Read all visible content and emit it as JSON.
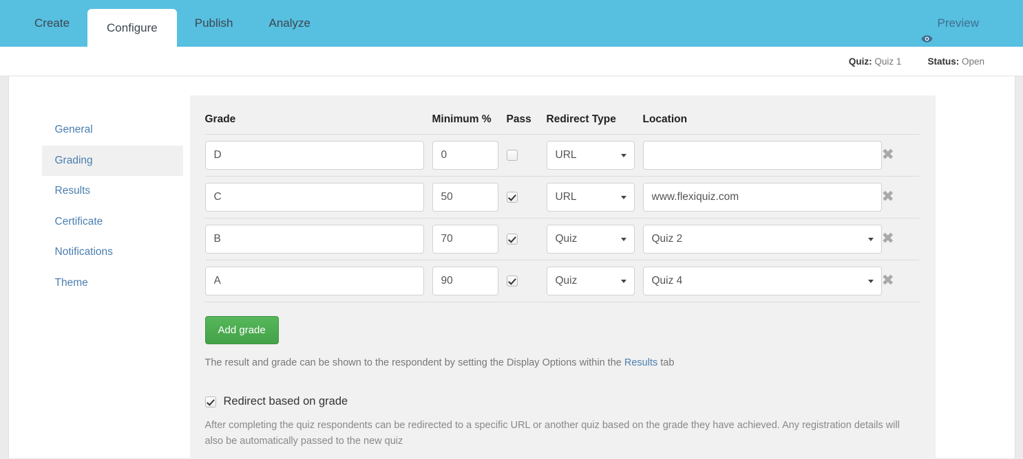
{
  "topbar": {
    "tabs": [
      {
        "label": "Create",
        "active": false
      },
      {
        "label": "Configure",
        "active": true
      },
      {
        "label": "Publish",
        "active": false
      },
      {
        "label": "Analyze",
        "active": false
      }
    ],
    "preview_label": "Preview",
    "preview_icon": "eye-icon",
    "accent_color": "#57bfdf"
  },
  "statusbar": {
    "quiz_label": "Quiz:",
    "quiz_value": "Quiz 1",
    "status_label": "Status:",
    "status_value": "Open"
  },
  "subnav": {
    "items": [
      {
        "label": "General",
        "active": false
      },
      {
        "label": "Grading",
        "active": true
      },
      {
        "label": "Results",
        "active": false
      },
      {
        "label": "Certificate",
        "active": false
      },
      {
        "label": "Notifications",
        "active": false
      },
      {
        "label": "Theme",
        "active": false
      }
    ]
  },
  "grades_table": {
    "headers": {
      "grade": "Grade",
      "minimum": "Minimum %",
      "pass": "Pass",
      "redirect_type": "Redirect Type",
      "location": "Location"
    },
    "rows": [
      {
        "grade": "D",
        "minimum": "0",
        "pass": false,
        "redirect_type": "URL",
        "location": "",
        "location_placeholder": "",
        "location_is_select": false,
        "delete_icon": "close-icon"
      },
      {
        "grade": "C",
        "minimum": "50",
        "pass": true,
        "redirect_type": "URL",
        "location": "www.flexiquiz.com",
        "location_placeholder": "",
        "location_is_select": false,
        "delete_icon": "close-icon"
      },
      {
        "grade": "B",
        "minimum": "70",
        "pass": true,
        "redirect_type": "Quiz",
        "location": "Quiz 2",
        "location_placeholder": "",
        "location_is_select": true,
        "delete_icon": "close-icon"
      },
      {
        "grade": "A",
        "minimum": "90",
        "pass": true,
        "redirect_type": "Quiz",
        "location": "Quiz 4",
        "location_placeholder": "",
        "location_is_select": true,
        "delete_icon": "close-icon"
      }
    ]
  },
  "actions": {
    "add_grade_label": "Add grade",
    "add_grade_color": "#4ca951",
    "help_text_before": "The result and grade can be shown to the respondent by setting the Display Options within the ",
    "help_link": "Results",
    "help_text_after": " tab"
  },
  "redirect_option": {
    "checked": true,
    "label": "Redirect based on grade",
    "description": "After completing the quiz respondents can be redirected to a specific URL or another quiz based on the grade they have achieved. Any registration details will also be automatically passed to the new quiz"
  }
}
